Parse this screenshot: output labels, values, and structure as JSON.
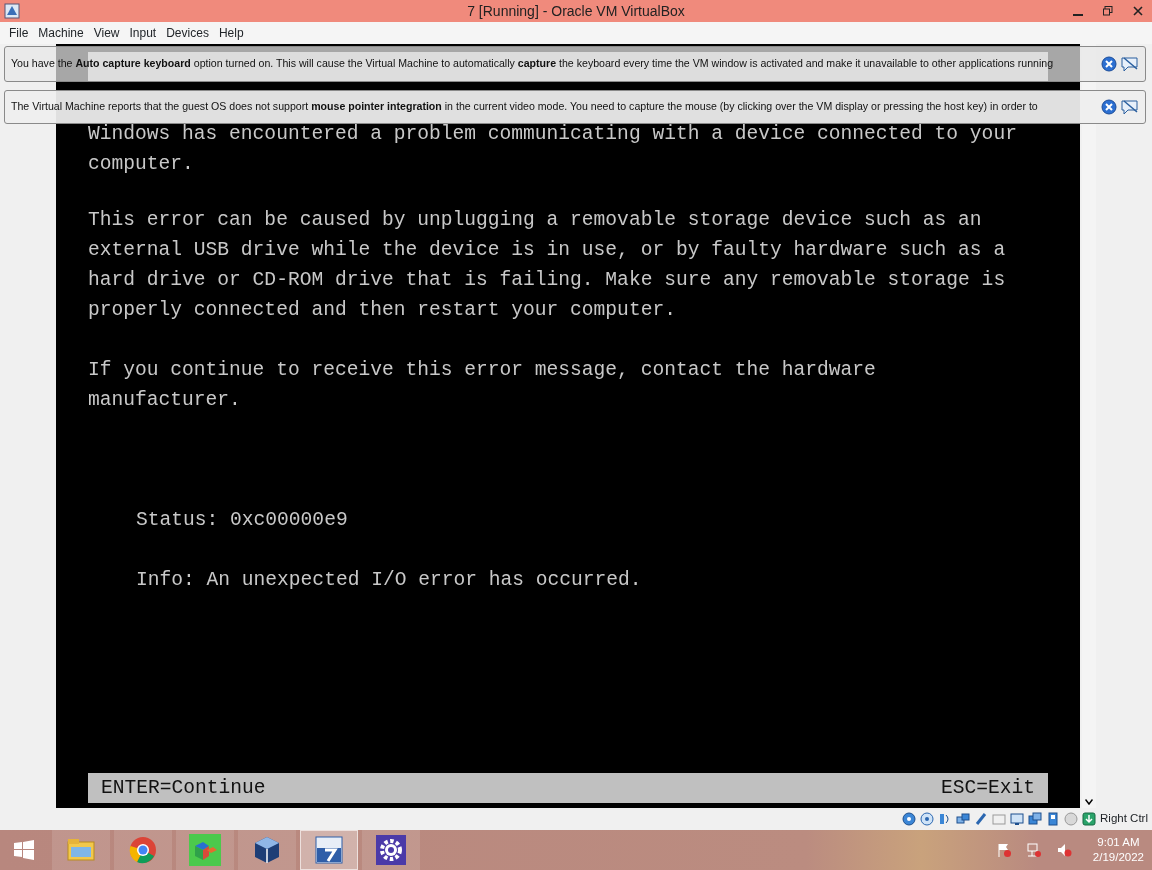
{
  "window": {
    "title": "7 [Running] - Oracle VM VirtualBox"
  },
  "menu": [
    "File",
    "Machine",
    "View",
    "Input",
    "Devices",
    "Help"
  ],
  "notifications": [
    {
      "text": "You have the **Auto capture keyboard** option turned on. This will cause the Virtual Machine to automatically **capture** the keyboard every time the VM window is activated and make it unavailable to other applications running"
    },
    {
      "text": "The Virtual Machine reports that the guest OS does not support **mouse pointer integration** in the current video mode. You need to capture the mouse (by clicking over the VM display or pressing the host key) in order to"
    }
  ],
  "vm_screen": {
    "paragraphs": [
      [
        "Windows has encountered a problem communicating with a device connected to your",
        "computer."
      ],
      [
        "This error can be caused by unplugging a removable storage device such as an",
        "external USB drive while the device is in use, or by faulty hardware such as a",
        "hard drive or CD-ROM drive that is failing. Make sure any removable storage is",
        "properly connected and then restart your computer."
      ],
      [
        "If you continue to receive this error message, contact the hardware",
        "manufacturer."
      ]
    ],
    "details": [
      "Status: 0xc00000e9",
      "Info: An unexpected I/O error has occurred."
    ],
    "footer_left": "ENTER=Continue",
    "footer_right": "ESC=Exit"
  },
  "status_bar": {
    "host_key": "Right Ctrl"
  },
  "taskbar": {
    "apps": [
      {
        "kind": "folder",
        "selected": false
      },
      {
        "kind": "browser",
        "selected": false
      },
      {
        "kind": "cubes",
        "selected": false
      },
      {
        "kind": "virtualbox",
        "selected": false
      },
      {
        "kind": "vm",
        "selected": true
      },
      {
        "kind": "settings",
        "selected": false
      }
    ],
    "time": "9:01 AM",
    "date": "2/19/2022"
  }
}
